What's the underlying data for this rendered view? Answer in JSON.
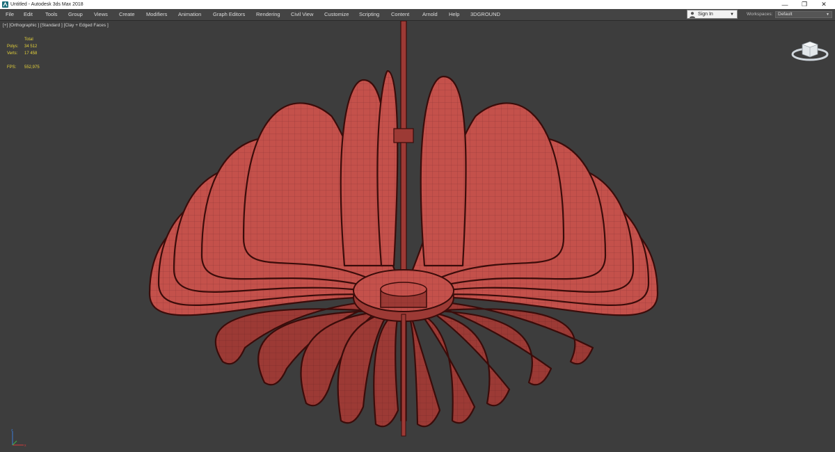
{
  "window": {
    "title": "Untitled - Autodesk 3ds Max 2018",
    "controls": {
      "minimize": "—",
      "restore": "❐",
      "close": "✕"
    }
  },
  "menu": [
    "File",
    "Edit",
    "Tools",
    "Group",
    "Views",
    "Create",
    "Modifiers",
    "Animation",
    "Graph Editors",
    "Rendering",
    "Civil View",
    "Customize",
    "Scripting",
    "Content",
    "Arnold",
    "Help",
    "3DGROUND"
  ],
  "account": {
    "signin_label": "Sign In",
    "workspaces_label": "Workspaces:",
    "workspace_value": "Default"
  },
  "viewport": {
    "label": "[+] [Orthographic ] [Standard ] [Clay + Edged Faces ]",
    "stats": {
      "total_label": "Total",
      "polys_label": "Polys:",
      "polys_value": "34 512",
      "verts_label": "Verts:",
      "verts_value": "17 458",
      "fps_label": "FPS:",
      "fps_value": "552,975"
    }
  },
  "colors": {
    "menubar": "#444444",
    "viewport_bg": "#3d3d3d",
    "petal_fill": "#c4514b",
    "petal_shadow": "#9c3a35",
    "petal_edge": "#3a0c0a",
    "stats_text": "#e6d33a"
  },
  "icons": {
    "app": "3dsmax-logo-icon",
    "user": "person-icon",
    "viewcube": "viewcube-icon",
    "axis": "axis-tripod-icon"
  }
}
